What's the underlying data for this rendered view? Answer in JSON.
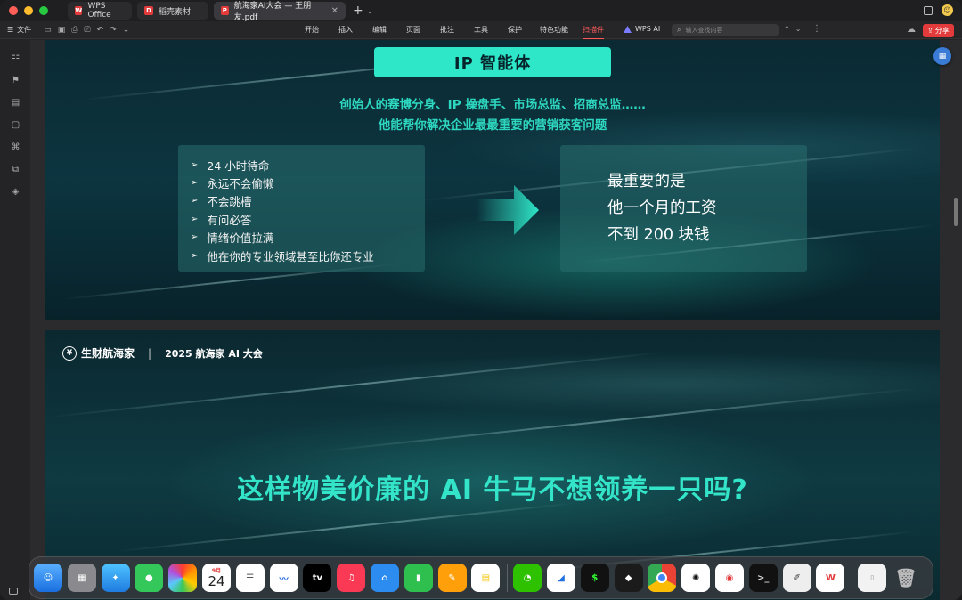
{
  "window": {
    "tabs": [
      {
        "label": "WPS Office",
        "logo": "W",
        "logo_color": "#e33b3b"
      },
      {
        "label": "稻壳素材",
        "logo": "D",
        "logo_color": "#e33b3b"
      },
      {
        "label": "航海家AI大会 — 王朋友.pdf",
        "logo": "P",
        "logo_color": "#e33b3b"
      }
    ]
  },
  "toolbar": {
    "file_label": "文件",
    "menu": [
      "开始",
      "插入",
      "编辑",
      "页面",
      "批注",
      "工具",
      "保护",
      "特色功能",
      "扫描件"
    ],
    "active_menu": "扫描件",
    "wps_ai_label": "WPS AI",
    "search_placeholder": "输入查找内容",
    "share_label": "分享"
  },
  "slide1": {
    "badge": "IP 智能体",
    "subtitle_line1": "创始人的赛博分身、IP 操盘手、市场总监、招商总监……",
    "subtitle_line2": "他能帮你解决企业最最重要的营销获客问题",
    "bullets": [
      "24 小时待命",
      "永远不会偷懒",
      "不会跳槽",
      "有问必答",
      "情绪价值拉满",
      "他在你的专业领域甚至比你还专业"
    ],
    "result_lines": [
      "最重要的是",
      "他一个月的工资",
      "不到 200 块钱"
    ]
  },
  "slide2": {
    "brand_name": "生财航海家",
    "separator": "|",
    "event": "2025 航海家 AI 大会",
    "headline": "这样物美价廉的 AI 牛马不想领养一只吗?"
  },
  "dock": {
    "calendar_month": "9月",
    "calendar_day": "24"
  },
  "colors": {
    "accent": "#2ee6c8",
    "share_red": "#e33b3b",
    "active_menu": "#ff5a5a"
  }
}
